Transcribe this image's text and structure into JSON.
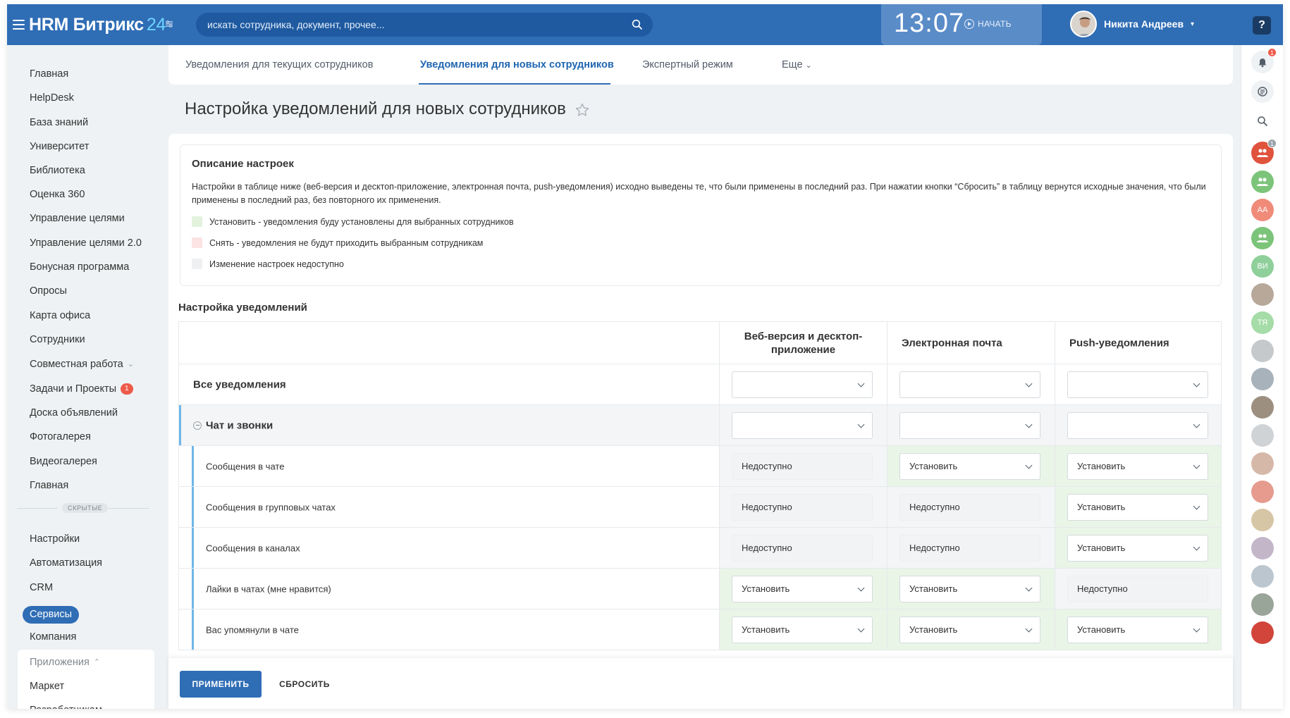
{
  "app": {
    "logo_main": "HRM Битрикс",
    "logo_num": "24"
  },
  "search": {
    "placeholder": "искать сотрудника, документ, прочее..."
  },
  "clock": {
    "time": "13:07",
    "start_label": "НАЧАТЬ"
  },
  "user": {
    "name": "Никита Андреев"
  },
  "help_label": "?",
  "sidebar": {
    "items": [
      "Главная",
      "HelpDesk",
      "База знаний",
      "Университет",
      "Библиотека",
      "Оценка 360",
      "Управление целями",
      "Управление целями 2.0",
      "Бонусная программа",
      "Опросы",
      "Карта офиса",
      "Сотрудники",
      "Совместная работа",
      "Задачи и Проекты",
      "Доска объявлений",
      "Фотогалерея",
      "Видеогалерея",
      "Главная"
    ],
    "tasks_count": "1",
    "hidden_label": "СКРЫТЫЕ",
    "hidden_items": [
      "Настройки",
      "Автоматизация",
      "CRM"
    ],
    "active_item": "Сервисы",
    "company": "Компания",
    "apps_label": "Приложения",
    "apps_items": [
      "Маркет",
      "Разработчикам"
    ]
  },
  "tabs": {
    "current": "Уведомления для текущих сотрудников",
    "new": "Уведомления для новых сотрудников",
    "expert": "Экспертный режим",
    "more": "Еще"
  },
  "page_title": "Настройка уведомлений для новых сотрудников",
  "description": {
    "title": "Описание настроек",
    "text": "Настройки в таблице ниже (веб-версия и десктоп-приложение, электронная почта, push-уведомления) исходно выведены те, что были применены в последний раз. При нажатии кнопки “Сбросить” в таблицу вернутся исходные значения, что были применены в последний раз, без повторного их применения.",
    "legend": [
      {
        "label": "Установить - уведомления буду установлены для выбранных сотрудников",
        "color": "#e2f2dd"
      },
      {
        "label": "Снять - уведомления не будут приходить выбранным сотрудникам",
        "color": "#fbe3e3"
      },
      {
        "label": "Изменение настроек недоступно",
        "color": "#eef0f2"
      }
    ]
  },
  "settings_title": "Настройка уведомлений",
  "table": {
    "columns": [
      "Веб-версия и десктоп-приложение",
      "Электронная почта",
      "Push-уведомления"
    ],
    "all_label": "Все уведомления",
    "group_label": "Чат и звонки",
    "rows": [
      {
        "label": "Сообщения в чате",
        "values": [
          "Недоступно",
          "Установить",
          "Установить"
        ]
      },
      {
        "label": "Сообщения в групповых чатах",
        "values": [
          "Недоступно",
          "Недоступно",
          "Установить"
        ]
      },
      {
        "label": "Сообщения в каналах",
        "values": [
          "Недоступно",
          "Недоступно",
          "Установить"
        ]
      },
      {
        "label": "Лайки в чатах (мне нравится)",
        "values": [
          "Установить",
          "Установить",
          "Недоступно"
        ]
      },
      {
        "label": "Вас упомянули в чате",
        "values": [
          "Установить",
          "Установить",
          "Установить"
        ]
      }
    ]
  },
  "footer": {
    "apply": "ПРИМЕНИТЬ",
    "reset": "СБРОСИТЬ"
  },
  "rail": {
    "notif_count": "1",
    "group_count": "1",
    "initials": [
      "АА",
      "ВИ",
      "ТЯ"
    ]
  },
  "colors": {
    "brand": "#2f6db5",
    "green_cell": "#e9f5e6",
    "disabled_cell": "#f4f5f6"
  }
}
